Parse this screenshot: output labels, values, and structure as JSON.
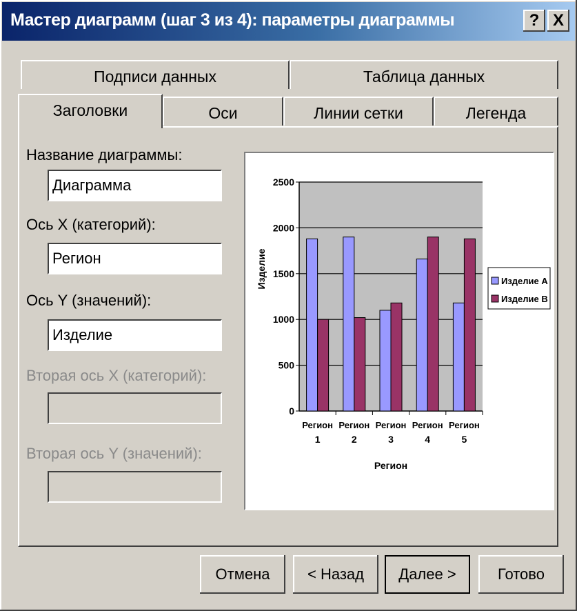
{
  "window": {
    "title": "Мастер диаграмм (шаг 3 из 4): параметры диаграммы",
    "help_button": "?",
    "close_button": "X"
  },
  "tabs_back": [
    "Подписи данных",
    "Таблица данных"
  ],
  "tabs_front": [
    "Заголовки",
    "Оси",
    "Линии сетки",
    "Легенда"
  ],
  "active_tab": "Заголовки",
  "form": {
    "chart_title_label": "Название диаграммы:",
    "chart_title_value": "Диаграмма",
    "x_axis_label": "Ось X (категорий):",
    "x_axis_value": "Регион",
    "y_axis_label": "Ось Y (значений):",
    "y_axis_value": "Изделие",
    "x2_axis_label": "Вторая ось X (категорий):",
    "x2_axis_value": "",
    "y2_axis_label": "Вторая ось Y (значений):",
    "y2_axis_value": ""
  },
  "buttons": {
    "cancel": "Отмена",
    "back": "< Назад",
    "next": "Далее >",
    "finish": "Готово"
  },
  "chart_data": {
    "type": "bar",
    "title": "",
    "categories": [
      [
        "Регион",
        "1"
      ],
      [
        "Регион",
        "2"
      ],
      [
        "Регион",
        "3"
      ],
      [
        "Регион",
        "4"
      ],
      [
        "Регион",
        "5"
      ]
    ],
    "series": [
      {
        "name": "Изделие А",
        "color": "#9999ff",
        "values": [
          1880,
          1900,
          1100,
          1660,
          1180
        ]
      },
      {
        "name": "Изделие В",
        "color": "#993366",
        "values": [
          1000,
          1020,
          1180,
          1900,
          1880
        ]
      }
    ],
    "xlabel": "Регион",
    "ylabel": "Изделие",
    "ylim": [
      0,
      2500
    ],
    "yticks": [
      "0",
      "500",
      "1000",
      "1500",
      "2000",
      "2500"
    ],
    "grid": true,
    "plot_background": "#c0c0c0",
    "legend": "right"
  }
}
